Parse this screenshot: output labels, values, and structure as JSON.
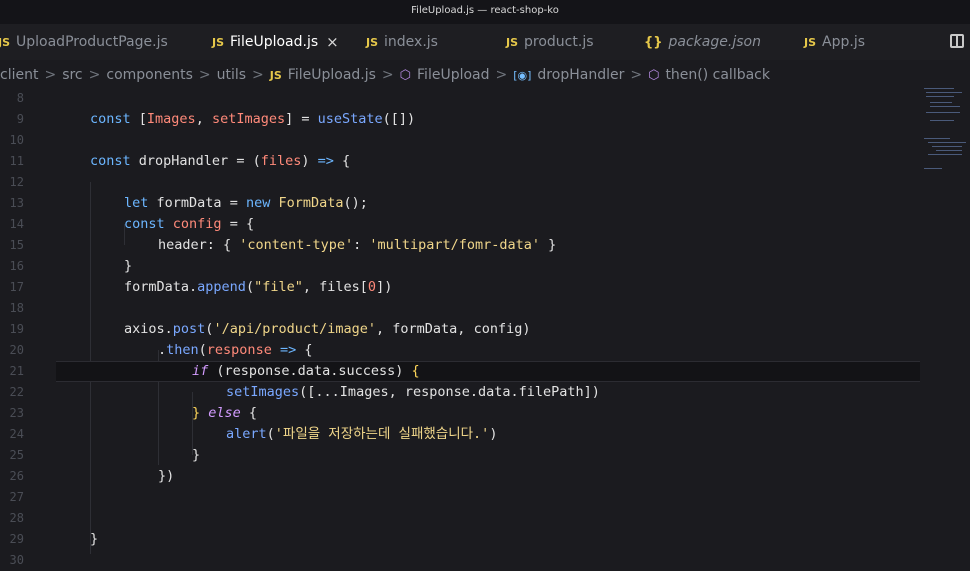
{
  "window": {
    "title": "FileUpload.js — react-shop-ko"
  },
  "tabs": [
    {
      "icon": "JS",
      "label": "UploadProductPage.js",
      "active": false
    },
    {
      "icon": "JS",
      "label": "FileUpload.js",
      "active": true,
      "close": "×"
    },
    {
      "icon": "JS",
      "label": "index.js",
      "active": false
    },
    {
      "icon": "JS",
      "label": "product.js",
      "active": false
    },
    {
      "icon": "{}",
      "label": "package.json",
      "active": false
    },
    {
      "icon": "JS",
      "label": "App.js",
      "active": false
    }
  ],
  "breadcrumb": {
    "items": [
      "client",
      "src",
      "components",
      "utils",
      "FileUpload.js",
      "FileUpload",
      "dropHandler",
      "then() callback"
    ],
    "js_badge": "JS",
    "separator": ">"
  },
  "editor": {
    "line_numbers": [
      "8",
      "9",
      "10",
      "11",
      "12",
      "13",
      "14",
      "15",
      "16",
      "17",
      "18",
      "19",
      "20",
      "21",
      "22",
      "23",
      "24",
      "25",
      "26",
      "27",
      "28",
      "29",
      "30"
    ],
    "tokens": {
      "const": "const",
      "let": "let",
      "new": "new",
      "if": "if",
      "else": "else",
      "Images": "Images",
      "setImages": "setImages",
      "useState": "useState",
      "dropHandler": "dropHandler",
      "files": "files",
      "formData": "formData",
      "FormData": "FormData",
      "config": "config",
      "header": "header",
      "content_type": "'content-type'",
      "multipart": "'multipart/fomr-data'",
      "append": "append",
      "file_str": "\"file\"",
      "zero": "0",
      "axios": "axios",
      "post": "post",
      "api_path": "'/api/product/image'",
      "then": "then",
      "response": "response",
      "data_success": "(response.data.success)",
      "spread": "[...Images, response.data.filePath]",
      "alert": "alert",
      "alert_msg": "'파일을 저장하는데 실패했습니다.'",
      "arrow": "=>"
    }
  }
}
